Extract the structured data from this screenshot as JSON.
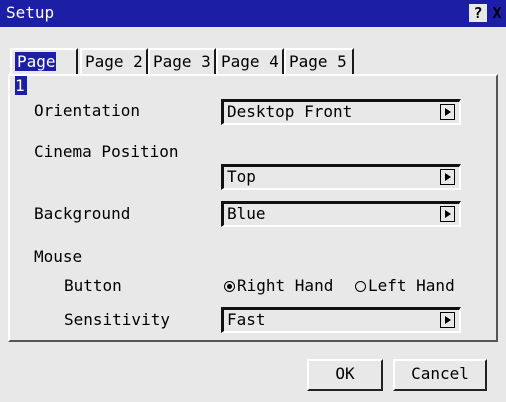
{
  "window": {
    "title": "Setup",
    "help_label": "?",
    "close_label": "X"
  },
  "tabs": [
    {
      "label": "Page 1",
      "active": true
    },
    {
      "label": "Page 2",
      "active": false
    },
    {
      "label": "Page 3",
      "active": false
    },
    {
      "label": "Page 4",
      "active": false
    },
    {
      "label": "Page 5",
      "active": false
    }
  ],
  "settings": {
    "orientation": {
      "label": "Orientation",
      "value": "Desktop Front"
    },
    "cinema_position": {
      "label": "Cinema Position",
      "value": "Top"
    },
    "background": {
      "label": "Background",
      "value": "Blue"
    },
    "mouse": {
      "label": "Mouse",
      "button": {
        "label": "Button",
        "options": [
          "Right Hand",
          "Left Hand"
        ],
        "selected": "Right Hand"
      },
      "sensitivity": {
        "label": "Sensitivity",
        "value": "Fast"
      }
    }
  },
  "buttons": {
    "ok": "OK",
    "cancel": "Cancel"
  },
  "colors": {
    "titlebar": "#1c1ea6",
    "face": "#e8e8e8"
  }
}
